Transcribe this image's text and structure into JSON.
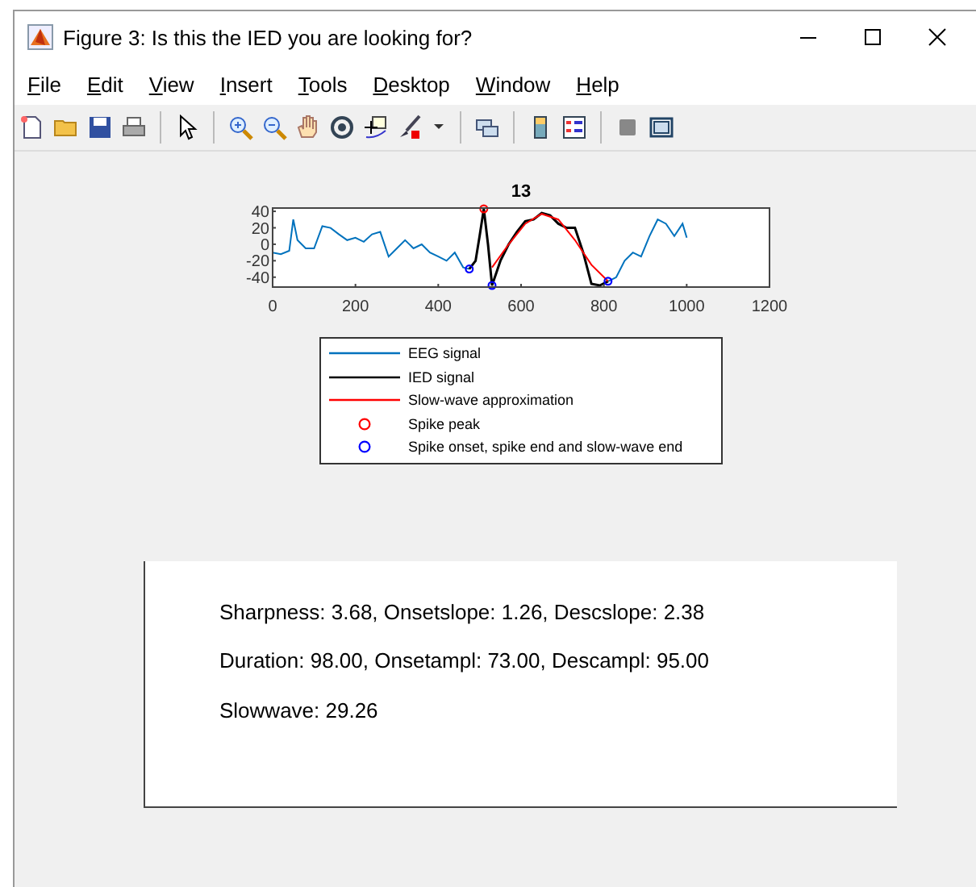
{
  "window": {
    "title": "Figure 3: Is this the IED you are looking for?"
  },
  "menu": [
    {
      "label": "File"
    },
    {
      "label": "Edit"
    },
    {
      "label": "View"
    },
    {
      "label": "Insert"
    },
    {
      "label": "Tools"
    },
    {
      "label": "Desktop"
    },
    {
      "label": "Window"
    },
    {
      "label": "Help"
    }
  ],
  "axes": {
    "chart_data": {
      "type": "line",
      "title": "13",
      "xlim": [
        0,
        1200
      ],
      "ylim": [
        -52,
        44
      ],
      "xticks": [
        0,
        200,
        400,
        600,
        800,
        1000,
        1200
      ],
      "yticks": [
        -40,
        -20,
        0,
        20,
        40
      ],
      "series": [
        {
          "name": "EEG signal",
          "color": "#0072bd",
          "x": [
            0,
            20,
            40,
            50,
            60,
            80,
            100,
            120,
            140,
            160,
            180,
            200,
            220,
            240,
            260,
            280,
            300,
            320,
            340,
            360,
            380,
            400,
            420,
            440,
            460,
            475,
            640,
            810,
            830,
            850,
            870,
            890,
            910,
            930,
            950,
            970,
            990,
            1000
          ],
          "values": [
            -10,
            -12,
            -8,
            30,
            5,
            -5,
            -5,
            22,
            20,
            12,
            5,
            8,
            3,
            12,
            15,
            -15,
            -5,
            5,
            -5,
            0,
            -10,
            -15,
            -20,
            -10,
            -28,
            -30,
            null,
            -45,
            -40,
            -20,
            -10,
            -15,
            10,
            30,
            25,
            10,
            25,
            8
          ]
        },
        {
          "name": "IED signal",
          "color": "#000000",
          "x": [
            475,
            490,
            500,
            510,
            520,
            530,
            550,
            570,
            590,
            610,
            630,
            650,
            670,
            690,
            710,
            730,
            750,
            770,
            790,
            810
          ],
          "values": [
            -30,
            -20,
            10,
            43,
            0,
            -50,
            -20,
            0,
            15,
            28,
            30,
            38,
            35,
            25,
            20,
            20,
            -10,
            -48,
            -50,
            -45
          ]
        },
        {
          "name": "Slow-wave approximation",
          "color": "#ff0000",
          "x": [
            530,
            570,
            610,
            650,
            690,
            730,
            770,
            810
          ],
          "values": [
            -28,
            0,
            25,
            37,
            30,
            5,
            -25,
            -45
          ]
        },
        {
          "name": "Spike peak",
          "color": "#ff0000",
          "type": "scatter",
          "marker": "circle",
          "x": [
            510
          ],
          "values": [
            43
          ]
        },
        {
          "name": "Spike onset, spike end and slow-wave end",
          "color": "#0000ff",
          "type": "scatter",
          "marker": "circle",
          "x": [
            475,
            530,
            810
          ],
          "values": [
            -30,
            -50,
            -45
          ]
        }
      ]
    }
  },
  "text_panel": {
    "lines": [
      "Sharpness: 3.68, Onsetslope: 1.26, Descslope: 2.38",
      "Duration: 98.00, Onsetampl: 73.00, Descampl: 95.00",
      "Slowwave: 29.26"
    ]
  }
}
